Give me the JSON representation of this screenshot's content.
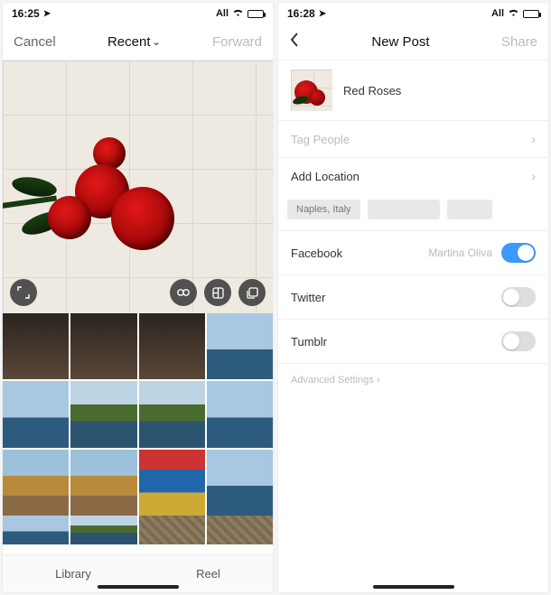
{
  "left": {
    "status": {
      "time": "16:25",
      "carrier": "All"
    },
    "nav": {
      "cancel": "Cancel",
      "title": "Recent",
      "forward": "Forward"
    },
    "tabs": {
      "library": "Library",
      "reel": "Reel"
    }
  },
  "right": {
    "status": {
      "time": "16:28",
      "carrier": "All"
    },
    "nav": {
      "title": "New Post",
      "share": "Share"
    },
    "caption": "Red Roses",
    "rows": {
      "tag_people": "Tag People",
      "add_location": "Add Location"
    },
    "chips": [
      "Naples, Italy"
    ],
    "sharing": {
      "facebook": {
        "label": "Facebook",
        "account": "Martina Oliva",
        "on": true
      },
      "twitter": {
        "label": "Twitter",
        "on": false
      },
      "tumblr": {
        "label": "Tumblr",
        "on": false
      }
    },
    "advanced": "Advanced Settings ›"
  }
}
